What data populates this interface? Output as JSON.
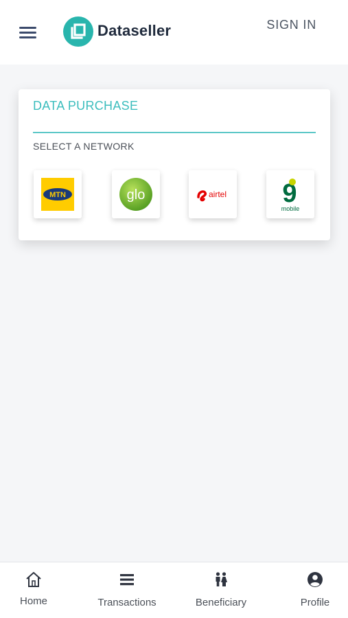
{
  "header": {
    "brand_name": "Dataseller",
    "sign_in_label": "SIGN IN"
  },
  "card": {
    "title": "DATA PURCHASE",
    "select_label": "SELECT A NETWORK",
    "networks": [
      {
        "name": "MTN",
        "logo_text": "MTN"
      },
      {
        "name": "Glo",
        "logo_text": "glo"
      },
      {
        "name": "Airtel",
        "logo_text": "airtel"
      },
      {
        "name": "9mobile",
        "logo_text": "9",
        "logo_subtext": "mobile"
      }
    ]
  },
  "bottom_nav": {
    "items": [
      {
        "label": "Home",
        "icon": "home-icon"
      },
      {
        "label": "Transactions",
        "icon": "list-icon"
      },
      {
        "label": "Beneficiary",
        "icon": "people-icon"
      },
      {
        "label": "Profile",
        "icon": "user-circle-icon"
      }
    ]
  },
  "colors": {
    "accent": "#3bbdbd",
    "brand_teal": "#29b5ad",
    "text_dark": "#1f2a3c",
    "mtn_yellow": "#ffcc00",
    "glo_green": "#6ab82e",
    "airtel_red": "#e40000",
    "nine_mobile_green": "#006b3f"
  }
}
